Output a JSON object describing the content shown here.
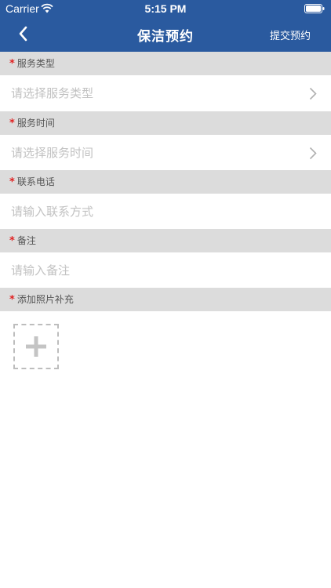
{
  "status_bar": {
    "carrier": "Carrier",
    "time": "5:15 PM"
  },
  "nav": {
    "title": "保洁预约",
    "submit_label": "提交预约"
  },
  "form": {
    "service_type": {
      "label": "服务类型",
      "placeholder": "请选择服务类型"
    },
    "service_time": {
      "label": "服务时间",
      "placeholder": "请选择服务时间"
    },
    "phone": {
      "label": "联系电话",
      "placeholder": "请输入联系方式"
    },
    "remark": {
      "label": "备注",
      "placeholder": "请输入备注"
    },
    "photos": {
      "label": "添加照片补充"
    }
  },
  "required_marker": "*",
  "colors": {
    "nav_bg": "#2a5a9f",
    "section_bg": "#dcdcdc",
    "required": "#e02020",
    "placeholder": "#c2c2c2"
  },
  "icons": [
    "wifi-icon",
    "battery-icon",
    "back-chevron-icon",
    "chevron-right-icon",
    "plus-icon"
  ]
}
